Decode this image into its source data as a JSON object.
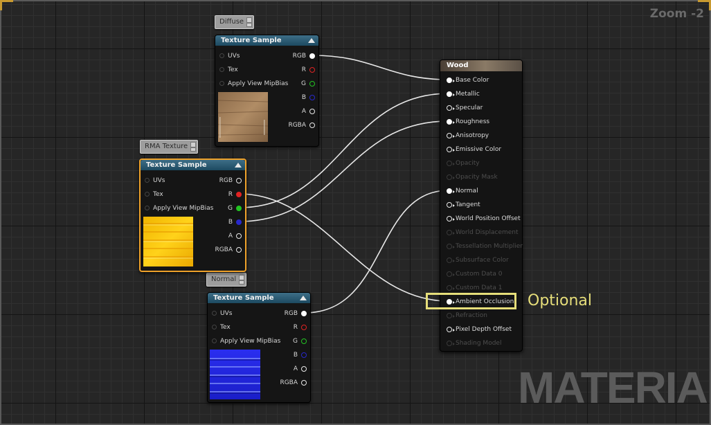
{
  "zoom": "Zoom -2",
  "watermark": "MATERIAL",
  "annotation": "Optional",
  "nodes": [
    {
      "comment": "Diffuse",
      "title": "Texture Sample",
      "inputs": [
        "UVs",
        "Tex",
        "Apply View MipBias"
      ],
      "outputs": [
        {
          "label": "RGB",
          "color": "white",
          "connected": true
        },
        {
          "label": "R",
          "color": "red",
          "connected": false
        },
        {
          "label": "G",
          "color": "green",
          "connected": false
        },
        {
          "label": "B",
          "color": "blue",
          "connected": false
        },
        {
          "label": "A",
          "color": "white",
          "connected": false
        },
        {
          "label": "RGBA",
          "color": "white",
          "connected": false
        }
      ],
      "thumbnail": "wood-diffuse-texture"
    },
    {
      "comment": "RMA Texture",
      "title": "Texture Sample",
      "inputs": [
        "UVs",
        "Tex",
        "Apply View MipBias"
      ],
      "outputs": [
        {
          "label": "RGB",
          "color": "white",
          "connected": false
        },
        {
          "label": "R",
          "color": "red",
          "connected": true
        },
        {
          "label": "G",
          "color": "green",
          "connected": true
        },
        {
          "label": "B",
          "color": "blue",
          "connected": true
        },
        {
          "label": "A",
          "color": "white",
          "connected": false
        },
        {
          "label": "RGBA",
          "color": "white",
          "connected": false
        }
      ],
      "thumbnail": "rma-texture"
    },
    {
      "comment": "Normal",
      "title": "Texture Sample",
      "inputs": [
        "UVs",
        "Tex",
        "Apply View MipBias"
      ],
      "outputs": [
        {
          "label": "RGB",
          "color": "white",
          "connected": true
        },
        {
          "label": "R",
          "color": "red",
          "connected": false
        },
        {
          "label": "G",
          "color": "green",
          "connected": false
        },
        {
          "label": "B",
          "color": "blue",
          "connected": false
        },
        {
          "label": "A",
          "color": "white",
          "connected": false
        },
        {
          "label": "RGBA",
          "color": "white",
          "connected": false
        }
      ],
      "thumbnail": "normal-map-texture"
    }
  ],
  "material": {
    "title": "Wood",
    "pins": [
      {
        "label": "Base Color",
        "state": "connected"
      },
      {
        "label": "Metallic",
        "state": "connected"
      },
      {
        "label": "Specular",
        "state": "enabled"
      },
      {
        "label": "Roughness",
        "state": "connected"
      },
      {
        "label": "Anisotropy",
        "state": "enabled"
      },
      {
        "label": "Emissive Color",
        "state": "enabled"
      },
      {
        "label": "Opacity",
        "state": "disabled"
      },
      {
        "label": "Opacity Mask",
        "state": "disabled"
      },
      {
        "label": "Normal",
        "state": "connected"
      },
      {
        "label": "Tangent",
        "state": "enabled"
      },
      {
        "label": "World Position Offset",
        "state": "enabled"
      },
      {
        "label": "World Displacement",
        "state": "disabled"
      },
      {
        "label": "Tessellation Multiplier",
        "state": "disabled"
      },
      {
        "label": "Subsurface Color",
        "state": "disabled"
      },
      {
        "label": "Custom Data 0",
        "state": "disabled"
      },
      {
        "label": "Custom Data 1",
        "state": "disabled"
      },
      {
        "label": "Ambient Occlusion",
        "state": "connected"
      },
      {
        "label": "Refraction",
        "state": "disabled"
      },
      {
        "label": "Pixel Depth Offset",
        "state": "enabled"
      },
      {
        "label": "Shading Model",
        "state": "disabled"
      }
    ]
  },
  "colors": {
    "pin_red": "#e12323",
    "pin_green": "#23c423",
    "pin_blue": "#2828cc",
    "highlight": "#e6de7a",
    "selection": "#f0a22a",
    "node_header": "#2a5b73"
  }
}
